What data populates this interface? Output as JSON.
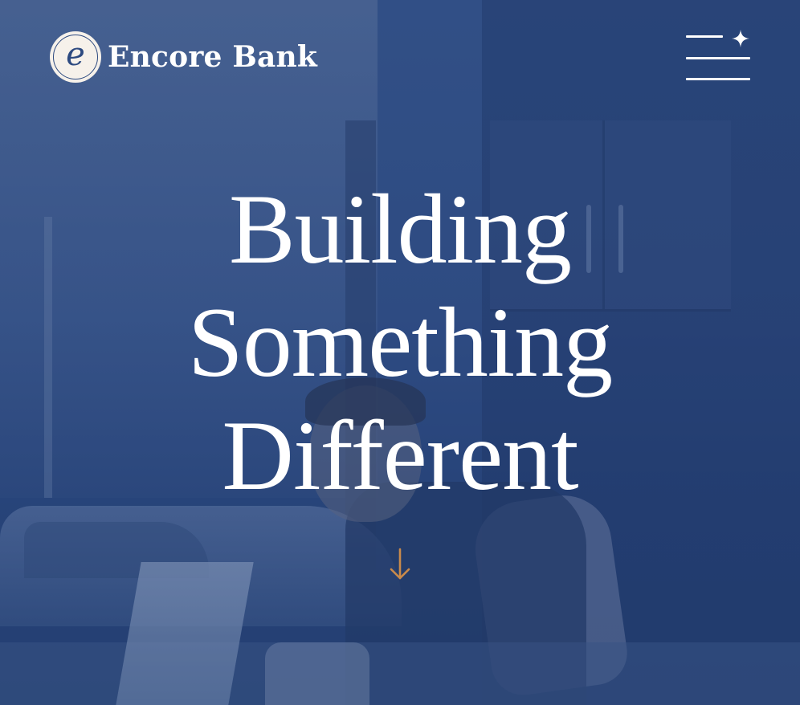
{
  "brand": {
    "logo_letter": "e",
    "name": "Encore Bank"
  },
  "header": {
    "menu_icon": "hamburger-menu-icon",
    "sparkle_icon": "sparkle-icon"
  },
  "hero": {
    "headline_lines": [
      "Building",
      "Something",
      "Different"
    ],
    "scroll_icon": "arrow-down-icon"
  },
  "colors": {
    "overlay_blue": "#2c4a80",
    "text": "#ffffff",
    "accent_gold": "#c98a4b",
    "logo_badge_bg": "#f6f1ea"
  }
}
